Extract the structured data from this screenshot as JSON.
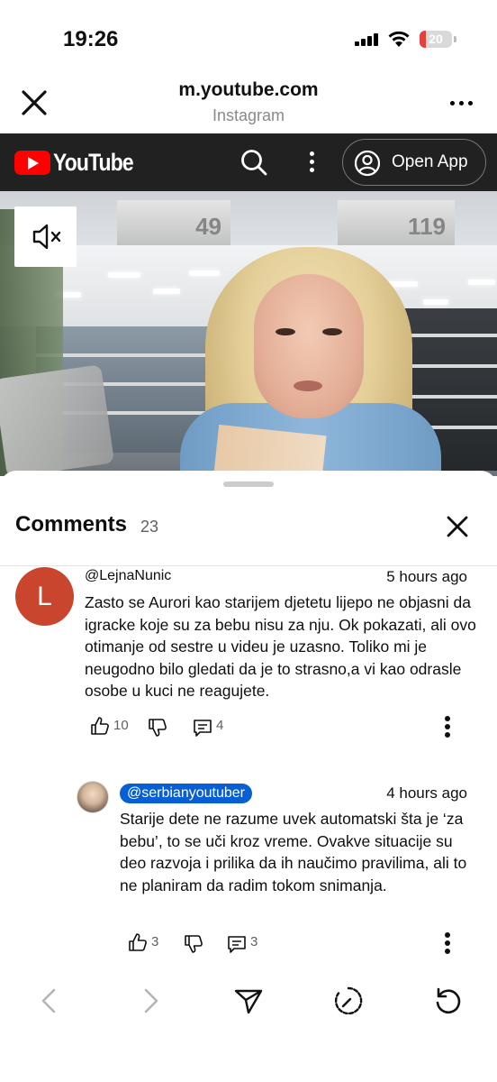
{
  "status_bar": {
    "time": "19:26",
    "battery": "20",
    "battery_level": 0.2
  },
  "browser": {
    "url": "m.youtube.com",
    "source": "Instagram"
  },
  "youtube": {
    "logo_text": "YouTube",
    "open_app_label": "Open App"
  },
  "video": {
    "price_left": "49",
    "price_right": "119"
  },
  "comments": {
    "title": "Comments",
    "count": "23",
    "items": [
      {
        "author": "@LejnaNunic",
        "avatar_letter": "L",
        "time": "5 hours ago",
        "text": "Zasto se Aurori kao starijem djetetu lijepo ne objasni da igracke koje su za bebu nisu za nju. Ok pokazati, ali ovo otimanje od sestre u videu je uzasno. Toliko mi je neugodno bilo gledati da je to strasno,a vi kao odrasle osobe u kuci ne reagujete.",
        "likes": "10",
        "replies": "4"
      },
      {
        "author": "@serbianyoutuber",
        "time": "4 hours ago",
        "text": "Starije dete ne razume uvek automatski šta je ‘za bebu’, to se uči kroz vreme. Ovakve situacije su deo razvoja i prilika da ih naučimo pravilima, ali to ne planiram da radim tokom snimanja.",
        "likes": "3",
        "replies": "3"
      }
    ]
  },
  "colors": {
    "youtube_red": "#ff0000",
    "creator_badge": "#065fd4",
    "avatar_L": "#c9452e",
    "yt_bar": "#212121"
  }
}
